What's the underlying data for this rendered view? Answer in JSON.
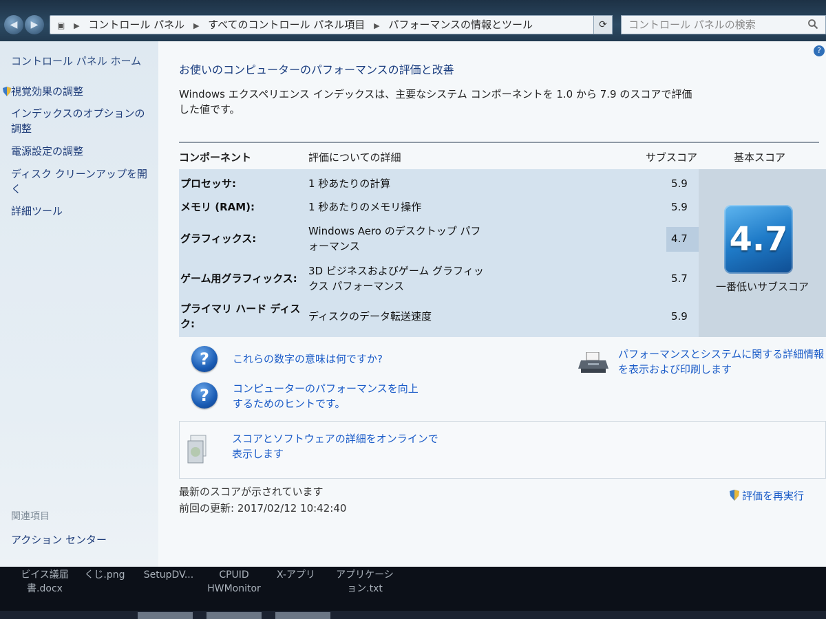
{
  "window": {
    "breadcrumb": [
      "コントロール パネル",
      "すべてのコントロール パネル項目",
      "パフォーマンスの情報とツール"
    ],
    "search_placeholder": "コントロール パネルの検索"
  },
  "sidebar": {
    "home": "コントロール パネル ホーム",
    "items": [
      {
        "label": "視覚効果の調整"
      },
      {
        "label": "インデックスのオプションの調整"
      },
      {
        "label": "電源設定の調整"
      },
      {
        "label": "ディスク クリーンアップを開く"
      },
      {
        "label": "詳細ツール"
      }
    ],
    "related_heading": "関連項目",
    "action_center": "アクション センター"
  },
  "main": {
    "heading": "お使いのコンピューターのパフォーマンスの評価と改善",
    "description": "Windows エクスペリエンス インデックスは、主要なシステム コンポーネントを 1.0 から 7.9 のスコアで評価した値です。",
    "columns": {
      "component": "コンポーネント",
      "details": "評価についての詳細",
      "subscore": "サブスコア",
      "basescore": "基本スコア"
    },
    "rows": [
      {
        "component": "プロセッサ:",
        "details": "1 秒あたりの計算",
        "subscore": "5.9"
      },
      {
        "component": "メモリ (RAM):",
        "details": "1 秒あたりのメモリ操作",
        "subscore": "5.9"
      },
      {
        "component": "グラフィックス:",
        "details": "Windows Aero のデスクトップ パフォーマンス",
        "subscore": "4.7"
      },
      {
        "component": "ゲーム用グラフィックス:",
        "details": "3D ビジネスおよびゲーム グラフィックス パフォーマンス",
        "subscore": "5.7"
      },
      {
        "component": "プライマリ ハード ディスク:",
        "details": "ディスクのデータ転送速度",
        "subscore": "5.9"
      }
    ],
    "base_score": "4.7",
    "base_caption": "一番低いサブスコア",
    "links": {
      "meaning": "これらの数字の意味は何ですか?",
      "tips": "コンピューターのパフォーマンスを向上するためのヒントです。",
      "print": "パフォーマンスとシステムに関する詳細情報を表示および印刷します",
      "online": "スコアとソフトウェアの詳細をオンラインで表示します"
    },
    "status": "最新のスコアが示されています",
    "last_update": "前回の更新: 2017/02/12 10:42:40",
    "rerun": "評価を再実行"
  },
  "desktop": {
    "items": [
      {
        "line1": "ビイス議届",
        "line2": "書.docx"
      },
      {
        "line1": "くじ.png",
        "line2": ""
      },
      {
        "line1": "SetupDV...",
        "line2": ""
      },
      {
        "line1": "CPUID",
        "line2": "HWMonitor"
      },
      {
        "line1": "X-アプリ",
        "line2": ""
      },
      {
        "line1": "アプリケーシ",
        "line2": "ョン.txt"
      }
    ]
  }
}
